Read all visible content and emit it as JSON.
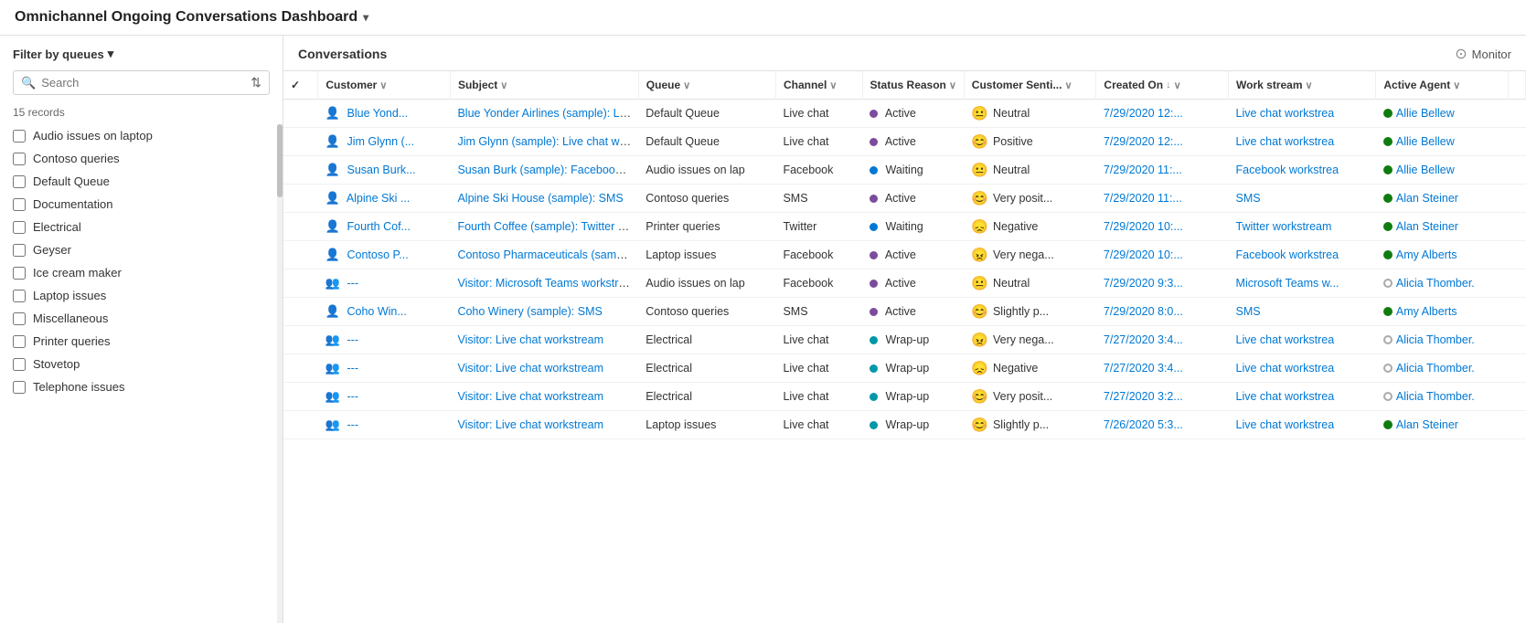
{
  "app": {
    "title": "Omnichannel Ongoing Conversations Dashboard",
    "title_chevron": "▾"
  },
  "sidebar": {
    "filter_label": "Filter by queues",
    "filter_chevron": "▾",
    "search_placeholder": "Search",
    "records_count": "15 records",
    "queues": [
      {
        "id": "audio-issues-on-laptop",
        "label": "Audio issues on laptop",
        "checked": false
      },
      {
        "id": "contoso-queries",
        "label": "Contoso queries",
        "checked": false
      },
      {
        "id": "default-queue",
        "label": "Default Queue",
        "checked": false
      },
      {
        "id": "documentation",
        "label": "Documentation",
        "checked": false
      },
      {
        "id": "electrical",
        "label": "Electrical",
        "checked": false
      },
      {
        "id": "geyser",
        "label": "Geyser",
        "checked": false
      },
      {
        "id": "ice-cream-maker",
        "label": "Ice cream maker",
        "checked": false
      },
      {
        "id": "laptop-issues",
        "label": "Laptop issues",
        "checked": false
      },
      {
        "id": "miscellaneous",
        "label": "Miscellaneous",
        "checked": false
      },
      {
        "id": "printer-queries",
        "label": "Printer queries",
        "checked": false
      },
      {
        "id": "stovetop",
        "label": "Stovetop",
        "checked": false
      },
      {
        "id": "telephone-issues",
        "label": "Telephone issues",
        "checked": false
      }
    ]
  },
  "conversations": {
    "title": "Conversations",
    "monitor_label": "Monitor"
  },
  "table": {
    "columns": [
      {
        "key": "check",
        "label": "✓",
        "sortable": false
      },
      {
        "key": "customer",
        "label": "Customer",
        "sortable": true
      },
      {
        "key": "subject",
        "label": "Subject",
        "sortable": true
      },
      {
        "key": "queue",
        "label": "Queue",
        "sortable": true
      },
      {
        "key": "channel",
        "label": "Channel",
        "sortable": true
      },
      {
        "key": "status",
        "label": "Status Reason",
        "sortable": true
      },
      {
        "key": "sentiment",
        "label": "Customer Senti...",
        "sortable": true
      },
      {
        "key": "created",
        "label": "Created On",
        "sortable": true,
        "sorted": "desc"
      },
      {
        "key": "workstream",
        "label": "Work stream",
        "sortable": true
      },
      {
        "key": "agent",
        "label": "Active Agent",
        "sortable": true
      }
    ],
    "rows": [
      {
        "customer_type": "person",
        "customer": "Blue Yond...",
        "subject": "Blue Yonder Airlines (sample): Live c",
        "queue": "Default Queue",
        "channel": "Live chat",
        "status_type": "active",
        "status": "Active",
        "sentiment_emoji": "😐",
        "sentiment": "Neutral",
        "created": "7/29/2020 12:...",
        "workstream": "Live chat workstrea",
        "agent_online": true,
        "agent": "Allie Bellew"
      },
      {
        "customer_type": "person",
        "customer": "Jim Glynn (...",
        "subject": "Jim Glynn (sample): Live chat works",
        "queue": "Default Queue",
        "channel": "Live chat",
        "status_type": "active",
        "status": "Active",
        "sentiment_emoji": "😊",
        "sentiment": "Positive",
        "created": "7/29/2020 12:...",
        "workstream": "Live chat workstrea",
        "agent_online": true,
        "agent": "Allie Bellew"
      },
      {
        "customer_type": "person",
        "customer": "Susan Burk...",
        "subject": "Susan Burk (sample): Facebook wor",
        "queue": "Audio issues on lap",
        "channel": "Facebook",
        "status_type": "waiting",
        "status": "Waiting",
        "sentiment_emoji": "😐",
        "sentiment": "Neutral",
        "created": "7/29/2020 11:...",
        "workstream": "Facebook workstrea",
        "agent_online": true,
        "agent": "Allie Bellew"
      },
      {
        "customer_type": "person",
        "customer": "Alpine Ski ...",
        "subject": "Alpine Ski House (sample): SMS",
        "queue": "Contoso queries",
        "channel": "SMS",
        "status_type": "active",
        "status": "Active",
        "sentiment_emoji": "😊",
        "sentiment": "Very posit...",
        "created": "7/29/2020 11:...",
        "workstream": "SMS",
        "agent_online": true,
        "agent": "Alan Steiner"
      },
      {
        "customer_type": "person",
        "customer": "Fourth Cof...",
        "subject": "Fourth Coffee (sample): Twitter wor",
        "queue": "Printer queries",
        "channel": "Twitter",
        "status_type": "waiting",
        "status": "Waiting",
        "sentiment_emoji": "😞",
        "sentiment": "Negative",
        "created": "7/29/2020 10:...",
        "workstream": "Twitter workstream",
        "agent_online": true,
        "agent": "Alan Steiner"
      },
      {
        "customer_type": "person",
        "customer": "Contoso P...",
        "subject": "Contoso Pharmaceuticals (sample):",
        "queue": "Laptop issues",
        "channel": "Facebook",
        "status_type": "active",
        "status": "Active",
        "sentiment_emoji": "😠",
        "sentiment": "Very nega...",
        "created": "7/29/2020 10:...",
        "workstream": "Facebook workstrea",
        "agent_online": true,
        "agent": "Amy Alberts"
      },
      {
        "customer_type": "visitor",
        "customer": "---",
        "subject": "Visitor: Microsoft Teams workstrea",
        "queue": "Audio issues on lap",
        "channel": "Facebook",
        "status_type": "active",
        "status": "Active",
        "sentiment_emoji": "😐",
        "sentiment": "Neutral",
        "created": "7/29/2020 9:3...",
        "workstream": "Microsoft Teams w...",
        "agent_online": false,
        "agent": "Alicia Thomber."
      },
      {
        "customer_type": "person",
        "customer": "Coho Win...",
        "subject": "Coho Winery (sample): SMS",
        "queue": "Contoso queries",
        "channel": "SMS",
        "status_type": "active",
        "status": "Active",
        "sentiment_emoji": "😊",
        "sentiment": "Slightly p...",
        "created": "7/29/2020 8:0...",
        "workstream": "SMS",
        "agent_online": true,
        "agent": "Amy Alberts"
      },
      {
        "customer_type": "visitor",
        "customer": "---",
        "subject": "Visitor: Live chat workstream",
        "queue": "Electrical",
        "channel": "Live chat",
        "status_type": "wrapup",
        "status": "Wrap-up",
        "sentiment_emoji": "😠",
        "sentiment": "Very nega...",
        "created": "7/27/2020 3:4...",
        "workstream": "Live chat workstrea",
        "agent_online": false,
        "agent": "Alicia Thomber."
      },
      {
        "customer_type": "visitor",
        "customer": "---",
        "subject": "Visitor: Live chat workstream",
        "queue": "Electrical",
        "channel": "Live chat",
        "status_type": "wrapup",
        "status": "Wrap-up",
        "sentiment_emoji": "😞",
        "sentiment": "Negative",
        "created": "7/27/2020 3:4...",
        "workstream": "Live chat workstrea",
        "agent_online": false,
        "agent": "Alicia Thomber."
      },
      {
        "customer_type": "visitor",
        "customer": "---",
        "subject": "Visitor: Live chat workstream",
        "queue": "Electrical",
        "channel": "Live chat",
        "status_type": "wrapup",
        "status": "Wrap-up",
        "sentiment_emoji": "😊",
        "sentiment": "Very posit...",
        "created": "7/27/2020 3:2...",
        "workstream": "Live chat workstrea",
        "agent_online": false,
        "agent": "Alicia Thomber."
      },
      {
        "customer_type": "visitor",
        "customer": "---",
        "subject": "Visitor: Live chat workstream",
        "queue": "Laptop issues",
        "channel": "Live chat",
        "status_type": "wrapup",
        "status": "Wrap-up",
        "sentiment_emoji": "😊",
        "sentiment": "Slightly p...",
        "created": "7/26/2020 5:3...",
        "workstream": "Live chat workstrea",
        "agent_online": true,
        "agent": "Alan Steiner"
      }
    ]
  }
}
